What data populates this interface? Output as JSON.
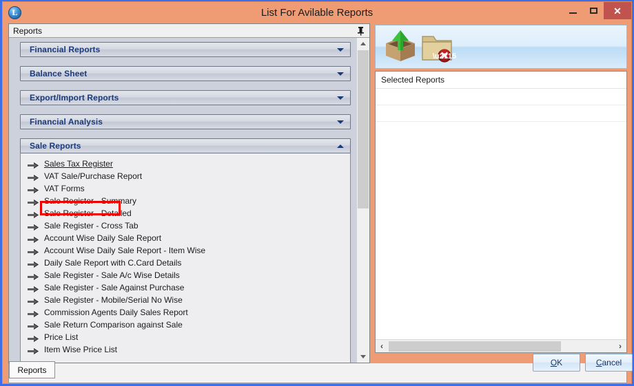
{
  "window": {
    "title": "List For Avilable Reports",
    "app_icon": "app-logo-icon",
    "icon_letter": "L",
    "minimize_label": "Minimize",
    "maximize_label": "Maximize",
    "close_label": "Close",
    "close_glyph": "✕",
    "frame_color": "#3b6ee8",
    "titlebar_color": "#ef9b74",
    "close_button_color": "#c1534f"
  },
  "dock": {
    "caption": "Reports",
    "pin_icon": "pin-icon"
  },
  "accordion": {
    "sections": [
      {
        "label": "Financial Reports",
        "expanded": false,
        "chevron": "chevron-down-icon"
      },
      {
        "label": "Balance Sheet",
        "expanded": false,
        "chevron": "chevron-down-icon"
      },
      {
        "label": "Export/Import Reports",
        "expanded": false,
        "chevron": "chevron-down-icon"
      },
      {
        "label": "Financial Analysis",
        "expanded": false,
        "chevron": "chevron-down-icon"
      },
      {
        "label": "Sale Reports",
        "expanded": true,
        "chevron": "chevron-up-icon"
      }
    ]
  },
  "sale_reports": {
    "items": [
      {
        "label": "Sales Tax Register",
        "selected": true,
        "highlighted": true
      },
      {
        "label": "VAT Sale/Purchase Report",
        "selected": false,
        "highlighted": false
      },
      {
        "label": "VAT Forms",
        "selected": false,
        "highlighted": false
      },
      {
        "label": "Sale Register - Summary",
        "selected": false,
        "highlighted": false
      },
      {
        "label": "Sale Register - Detailed",
        "selected": false,
        "highlighted": false
      },
      {
        "label": "Sale Register - Cross Tab",
        "selected": false,
        "highlighted": false
      },
      {
        "label": "Account Wise Daily Sale Report",
        "selected": false,
        "highlighted": false
      },
      {
        "label": "Account Wise Daily Sale Report - Item Wise",
        "selected": false,
        "highlighted": false
      },
      {
        "label": "Daily Sale Report with C.Card Details",
        "selected": false,
        "highlighted": false
      },
      {
        "label": "Sale Register - Sale A/c Wise Details",
        "selected": false,
        "highlighted": false
      },
      {
        "label": "Sale Register - Sale Against Purchase",
        "selected": false,
        "highlighted": false
      },
      {
        "label": "Sale Register - Mobile/Serial No Wise",
        "selected": false,
        "highlighted": false
      },
      {
        "label": "Commission Agents Daily Sales Report",
        "selected": false,
        "highlighted": false
      },
      {
        "label": "Sale Return Comparison against Sale",
        "selected": false,
        "highlighted": false
      },
      {
        "label": "Price List",
        "selected": false,
        "highlighted": false
      },
      {
        "label": "Item Wise Price List",
        "selected": false,
        "highlighted": false
      }
    ],
    "bullet_icon": "arrow-right-icon",
    "highlight_color": "#ee0000"
  },
  "toolbar": {
    "buttons": [
      {
        "name": "export-box-icon",
        "label": "Add Selected Report"
      },
      {
        "name": "folder-remove-icon",
        "label": "Remove Selected Report"
      }
    ]
  },
  "selected_panel": {
    "header": "Selected Reports",
    "rows": []
  },
  "scrollbars": {
    "vertical": {
      "up_icon": "scroll-up-icon",
      "down_icon": "scroll-down-icon"
    },
    "horizontal": {
      "left_glyph": "‹",
      "right_glyph": "›"
    }
  },
  "bottom": {
    "tab_label": "Reports",
    "ok_label": "OK",
    "ok_accel": "O",
    "cancel_label": "Cancel",
    "cancel_accel": "C"
  }
}
